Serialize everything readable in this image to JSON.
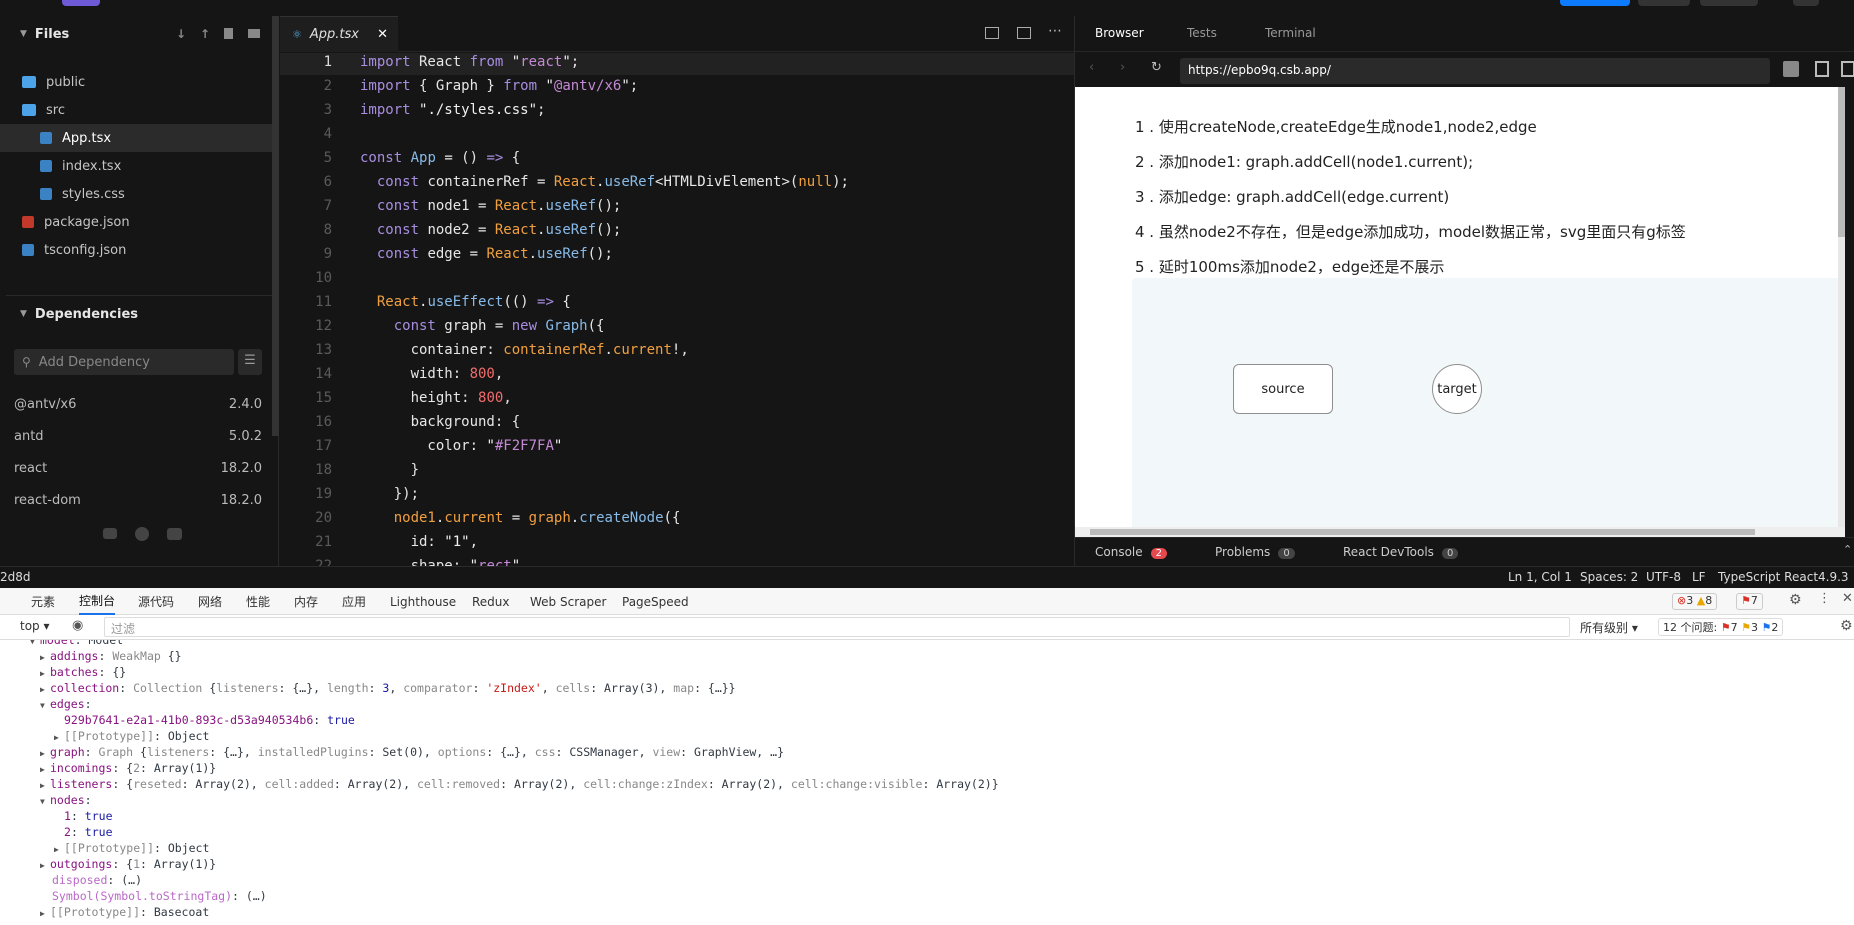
{
  "files": {
    "title": "Files",
    "items": [
      {
        "name": "public",
        "type": "folder"
      },
      {
        "name": "src",
        "type": "folder"
      },
      {
        "name": "App.tsx",
        "type": "tsx"
      },
      {
        "name": "index.tsx",
        "type": "tsx"
      },
      {
        "name": "styles.css",
        "type": "css"
      },
      {
        "name": "package.json",
        "type": "pkg"
      },
      {
        "name": "tsconfig.json",
        "type": "tsx"
      }
    ]
  },
  "dependencies": {
    "title": "Dependencies",
    "placeholder": "Add Dependency",
    "items": [
      {
        "name": "@antv/x6",
        "version": "2.4.0"
      },
      {
        "name": "antd",
        "version": "5.0.2"
      },
      {
        "name": "react",
        "version": "18.2.0"
      },
      {
        "name": "react-dom",
        "version": "18.2.0"
      }
    ]
  },
  "editor": {
    "tab_label": "App.tsx",
    "line_numbers": [
      "1",
      "2",
      "3",
      "4",
      "5",
      "6",
      "7",
      "8",
      "9",
      "10",
      "11",
      "12",
      "13",
      "14",
      "15",
      "16",
      "17",
      "18",
      "19",
      "20",
      "21",
      "22"
    ]
  },
  "browser": {
    "tabs": [
      "Browser",
      "Tests",
      "Terminal"
    ],
    "url": "https://epbo9q.csb.app/",
    "lines": [
      "1 . 使用createNode,createEdge生成node1,node2,edge",
      "2 . 添加node1: graph.addCell(node1.current);",
      "3 . 添加edge: graph.addCell(edge.current)",
      "4 .  虽然node2不存在，但是edge添加成功，model数据正常，svg里面只有g标签",
      "5 . 延时100ms添加node2，edge还是不展示"
    ],
    "node_source": "source",
    "node_target": "target",
    "bottom_tabs": [
      {
        "label": "Console",
        "badge": "2"
      },
      {
        "label": "Problems",
        "badge": "0"
      },
      {
        "label": "React DevTools",
        "badge": "0"
      }
    ]
  },
  "status": {
    "left": "2d8d",
    "items": [
      "Ln 1, Col 1",
      "Spaces: 2",
      "UTF-8",
      "LF",
      "TypeScript React",
      "4.9.3"
    ]
  },
  "devtools": {
    "tabs": [
      "元素",
      "控制台",
      "源代码",
      "网络",
      "性能",
      "内存",
      "应用",
      "Lighthouse",
      "Redux",
      "Web Scraper",
      "PageSpeed"
    ],
    "errors": "3",
    "warnings": "8",
    "issues_badge": "7",
    "context": "top",
    "filter_placeholder": "过滤",
    "levels": "所有级别",
    "issues_label": "12 个问题:",
    "issue_counts": [
      "7",
      "3",
      "2"
    ]
  }
}
